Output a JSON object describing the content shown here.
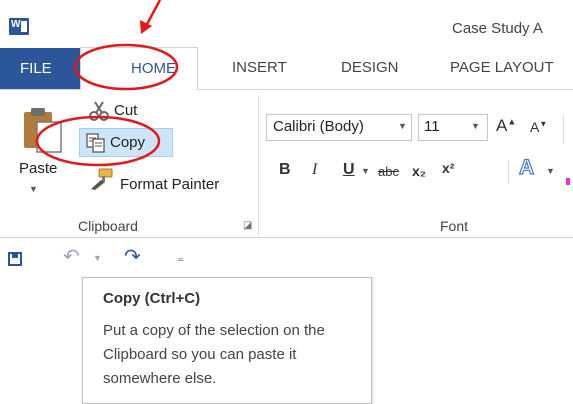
{
  "title_bar": {
    "doc_title": "Case Study A",
    "app_icon": "word-icon"
  },
  "tabs": [
    {
      "label": "FILE"
    },
    {
      "label": "HOME"
    },
    {
      "label": "INSERT"
    },
    {
      "label": "DESIGN"
    },
    {
      "label": "PAGE LAYOUT"
    }
  ],
  "clipboard": {
    "paste_label": "Paste",
    "cut_label": "Cut",
    "copy_label": "Copy",
    "format_painter_label": "Format Painter",
    "group_label": "Clipboard"
  },
  "font": {
    "font_name": "Calibri (Body)",
    "font_size": "11",
    "group_label": "Font",
    "bold": "B",
    "italic": "I",
    "underline": "U",
    "strikethrough": "abc",
    "subscript": "x₂",
    "superscript": "x²",
    "text_effects": "A"
  },
  "tooltip": {
    "title": "Copy (Ctrl+C)",
    "lines": [
      "Put a copy of the selection on the",
      "Clipboard so you can paste it",
      "somewhere else."
    ]
  },
  "colors": {
    "accent": "#2b579a",
    "highlight": "#cde6f7",
    "annotation": "#e0191c"
  }
}
